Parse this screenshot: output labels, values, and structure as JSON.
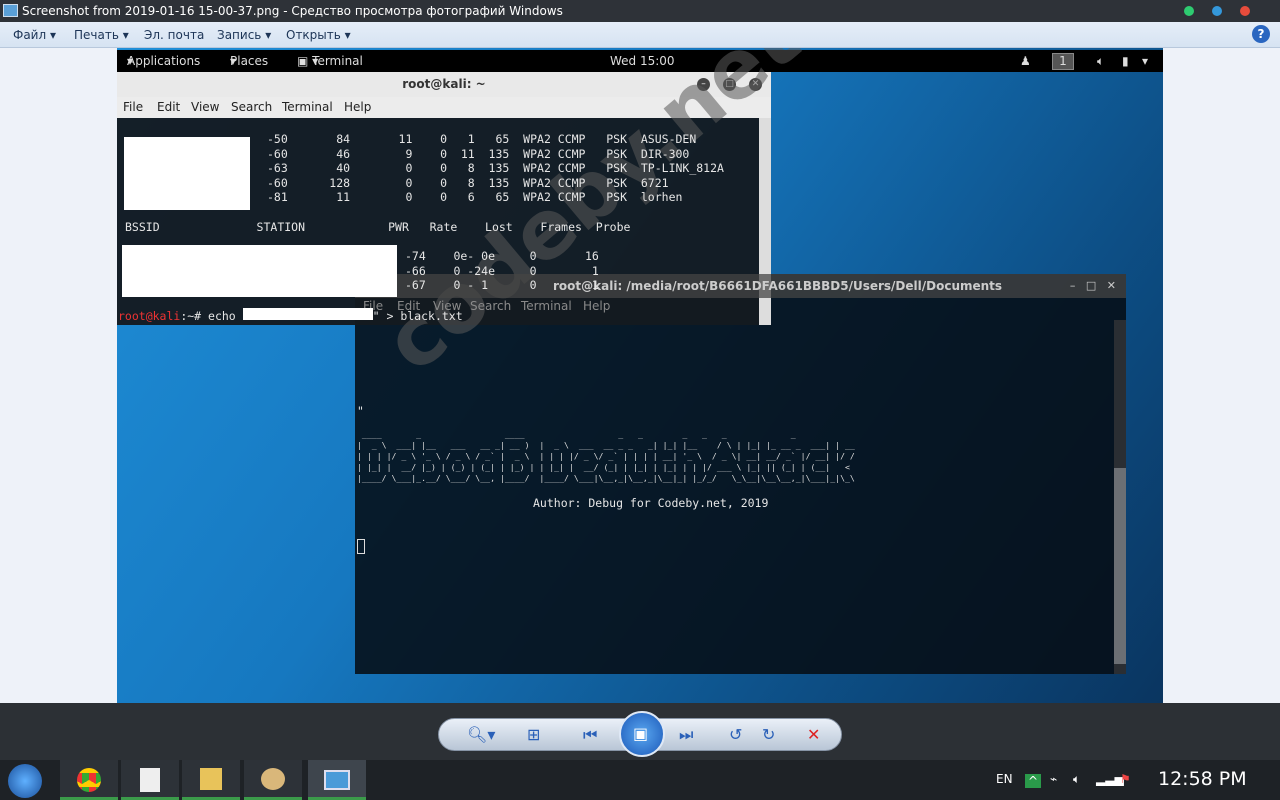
{
  "window": {
    "title": "Screenshot from 2019-01-16 15-00-37.png - Средство просмотра фотографий Windows"
  },
  "menubar": {
    "items": [
      "Файл",
      "Печать",
      "Эл. почта",
      "Запись",
      "Открыть"
    ],
    "help": "?"
  },
  "kali": {
    "applications": "Applications",
    "places": "Places",
    "terminal": "Terminal",
    "clock": "Wed 15:00",
    "workspace": "1"
  },
  "term1": {
    "title": "root@kali: ~",
    "menu": [
      "File",
      "Edit",
      "View",
      "Search",
      "Terminal",
      "Help"
    ],
    "ap_rows": [
      "-50       84       11    0   1   65  WPA2 CCMP   PSK  ASUS-DEN",
      "-60       46        9    0  11  135  WPA2 CCMP   PSK  DIR-300",
      "-63       40        0    0   8  135  WPA2 CCMP   PSK  TP-LINK_812A",
      "-60      128        0    0   8  135  WPA2 CCMP   PSK  6721",
      "-81       11        0    0   6   65  WPA2 CCMP   PSK  lorhen"
    ],
    "station_header": "BSSID              STATION            PWR   Rate    Lost    Frames  Probe",
    "station_rows": [
      "-74    0e- 0e     0       16",
      "-66    0 -24e     0        1",
      "-67    0 - 1      0        1"
    ],
    "prompt_user": "root@kali",
    "prompt_path": ":~#",
    "command": " echo ",
    "command_tail": "\" > black.txt"
  },
  "term2": {
    "title": "root@kali: /media/root/B6661DFA661BBBD5/Users/Dell/Documents",
    "menu": [
      "File",
      "Edit",
      "View",
      "Search",
      "Terminal",
      "Help"
    ],
    "quote": "\"",
    "ascii": [
      " ____       _                 ____                   _   _        _   _   _             _    ",
      "|  _ \\  ___| |__   ___   __ _| __ )  |  _ \\  ___  __ _ _   _| |_| |__    / \\ | |_| |_ __ _  ___| | __",
      "| | | |/ _ \\ '_ \\ / _ \\ / _` |  _ \\  | | | |/ _ \\/ _` | | | | __| '_ \\  / _ \\| __| __/ _` |/ __| |/ /",
      "| |_| |  __/ |_) | (_) | (_| | |_) | | |_| |  __/ (_| | |_| | |_| | | |/ ___ \\ |_| || (_| | (__|   < ",
      "|____/ \\___|_.__/ \\___/ \\__, |____/  |____/ \\___|\\__,_|\\__,_|\\__|_| |_/_/   \\_\\__|\\__\\__,_|\\___|_|\\_\\"
    ],
    "author": "Author: Debug for Codeby.net, 2019"
  },
  "watermark": "codeby.net",
  "tray": {
    "lang": "EN",
    "time": "12:58 PM"
  }
}
